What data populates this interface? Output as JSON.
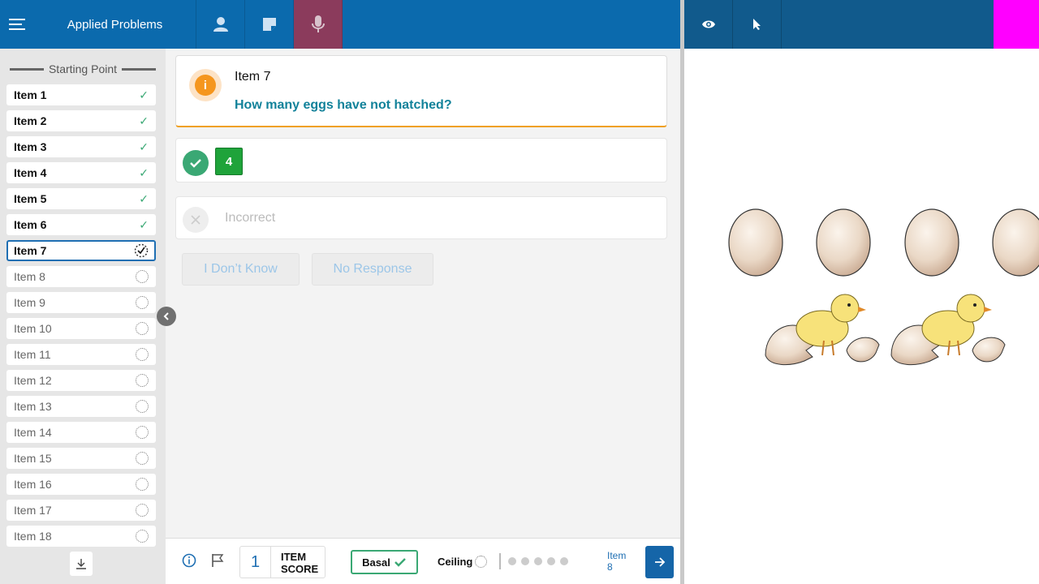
{
  "header": {
    "title": "Applied Problems",
    "menu_icon": "menu-icon",
    "buttons": [
      "person-icon",
      "note-icon",
      "microphone-icon"
    ],
    "right_buttons": [
      "eye-icon",
      "pointer-icon"
    ],
    "accent_color": "#0b6aad",
    "marker_color": "#ff00ff"
  },
  "sidebar": {
    "heading": "Starting Point",
    "items": [
      {
        "label": "Item 1",
        "status": "done"
      },
      {
        "label": "Item 2",
        "status": "done"
      },
      {
        "label": "Item 3",
        "status": "done"
      },
      {
        "label": "Item 4",
        "status": "done"
      },
      {
        "label": "Item 5",
        "status": "done"
      },
      {
        "label": "Item 6",
        "status": "done"
      },
      {
        "label": "Item 7",
        "status": "current"
      },
      {
        "label": "Item 8",
        "status": "pending"
      },
      {
        "label": "Item 9",
        "status": "pending"
      },
      {
        "label": "Item 10",
        "status": "pending"
      },
      {
        "label": "Item 11",
        "status": "pending"
      },
      {
        "label": "Item 12",
        "status": "pending"
      },
      {
        "label": "Item 13",
        "status": "pending"
      },
      {
        "label": "Item 14",
        "status": "pending"
      },
      {
        "label": "Item 15",
        "status": "pending"
      },
      {
        "label": "Item 16",
        "status": "pending"
      },
      {
        "label": "Item 17",
        "status": "pending"
      },
      {
        "label": "Item 18",
        "status": "pending"
      }
    ]
  },
  "question": {
    "title": "Item 7",
    "text": "How many eggs have not hatched?"
  },
  "response": {
    "answer": "4",
    "incorrect_label": "Incorrect",
    "dont_know_label": "I Don’t Know",
    "no_response_label": "No Response"
  },
  "footer": {
    "item_score_value": "1",
    "item_score_label_1": "ITEM",
    "item_score_label_2": "SCORE",
    "basal_label": "Basal",
    "ceiling_label": "Ceiling",
    "next_label_1": "Item",
    "next_label_2": "8"
  }
}
